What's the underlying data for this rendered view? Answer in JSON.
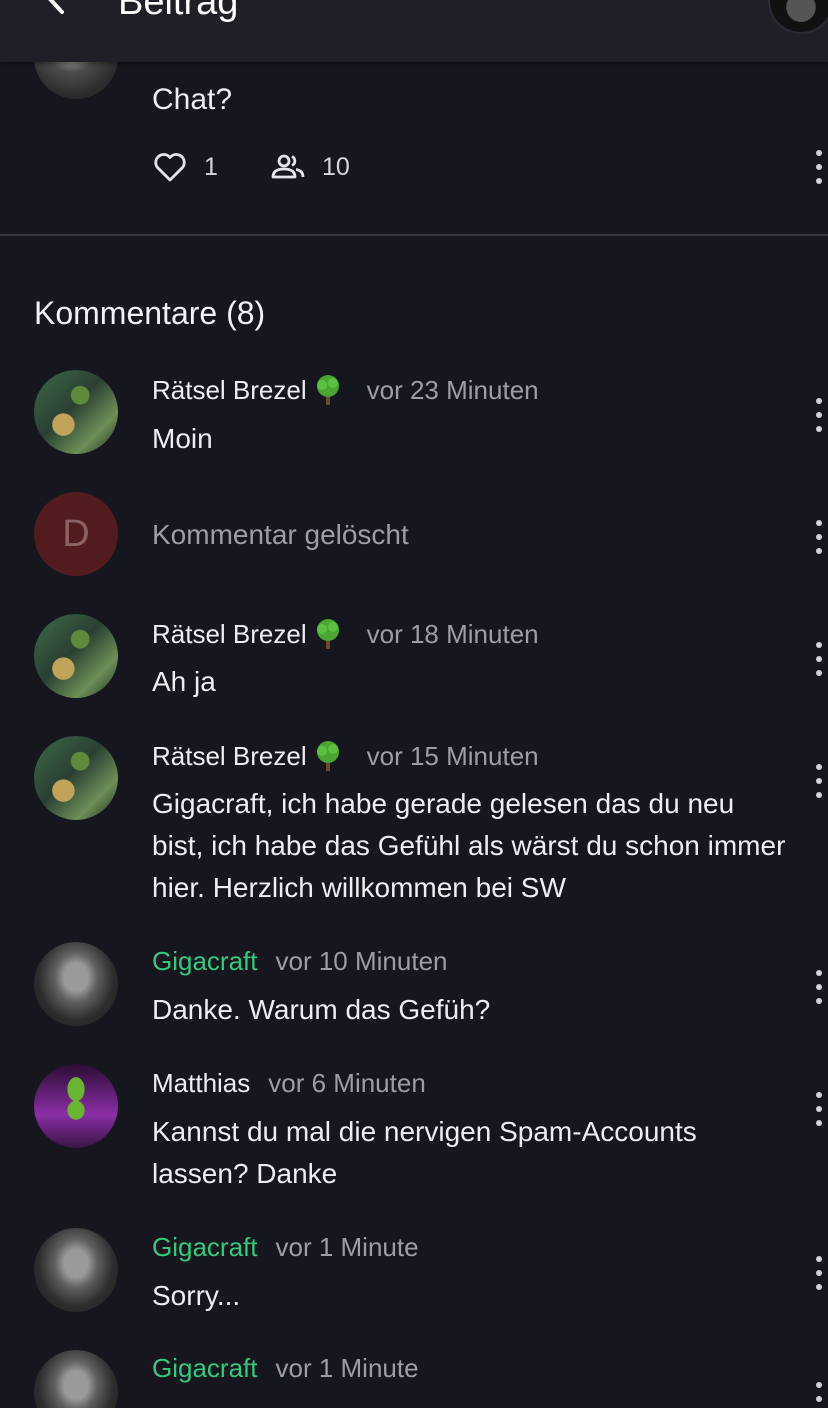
{
  "header": {
    "title": "Beitrag",
    "back_icon": "chevron-left-icon"
  },
  "post": {
    "text": "Chat?",
    "likes": "1",
    "participants": "10",
    "like_icon": "heart-icon",
    "participants_icon": "people-icon"
  },
  "comments_section": {
    "title": "Kommentare (8)",
    "comments": [
      {
        "author": "Rätsel Brezel",
        "badge": "tree-icon",
        "time": "vor 23 Minuten",
        "text": "Moin"
      },
      {
        "deleted": true,
        "avatar_letter": "D",
        "text": "Kommentar gelöscht"
      },
      {
        "author": "Rätsel Brezel",
        "badge": "tree-icon",
        "time": "vor 18 Minuten",
        "text": "Ah ja"
      },
      {
        "author": "Rätsel Brezel",
        "badge": "tree-icon",
        "time": "vor 15 Minuten",
        "text": "Gigacraft, ich habe gerade gelesen das du neu bist, ich habe das Gefühl als wärst du schon immer hier. Herzlich willkommen bei SW"
      },
      {
        "author": "Gigacraft",
        "author_color": "#2fca7a",
        "time": "vor 10 Minuten",
        "text": "Danke. Warum das Gefüh?"
      },
      {
        "author": "Matthias",
        "time": "vor 6 Minuten",
        "text": "Kannst du mal die nervigen Spam-Accounts lassen? Danke"
      },
      {
        "author": "Gigacraft",
        "author_color": "#2fca7a",
        "time": "vor 1 Minute",
        "text": "Sorry..."
      },
      {
        "author": "Gigacraft",
        "author_color": "#2fca7a",
        "time": "vor 1 Minute",
        "text": ""
      }
    ]
  },
  "colors": {
    "background": "#15161e",
    "header": "#1e1f27",
    "muted_text": "#9b9ea7",
    "author_highlight": "#2fca7a",
    "deleted_avatar": "#521c1f"
  }
}
